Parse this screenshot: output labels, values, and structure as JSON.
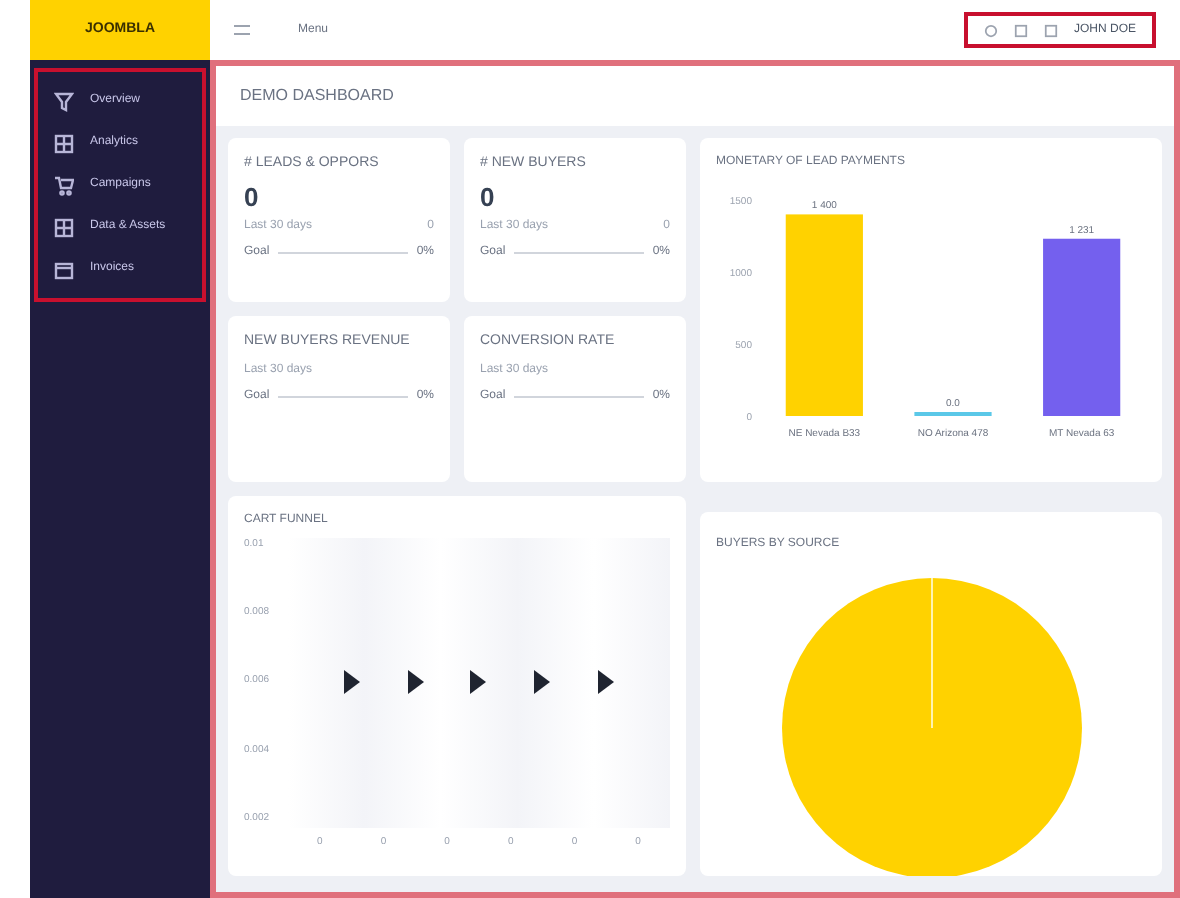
{
  "brand": "JOOMBLA",
  "topbar": {
    "menu_label": "Menu",
    "user": "JOHN DOE"
  },
  "sidebar": {
    "items": [
      {
        "label": "Overview",
        "kind": "funnel",
        "selected": false
      },
      {
        "label": "Analytics",
        "kind": "grid",
        "selected": false
      },
      {
        "label": "Campaigns",
        "kind": "cart",
        "selected": false
      },
      {
        "label": "Data & Assets",
        "kind": "grid",
        "selected": false
      },
      {
        "label": "Invoices",
        "kind": "calendar",
        "selected": false
      }
    ]
  },
  "page_title": "DEMO DASHBOARD",
  "metrics": [
    {
      "title": "# LEADS & OPPORS",
      "value": "0",
      "period": "Last 30 days",
      "period_value": "0",
      "goal_label": "Goal",
      "goal_value": "0%"
    },
    {
      "title": "# NEW BUYERS",
      "value": "0",
      "period": "Last 30 days",
      "period_value": "0",
      "goal_label": "Goal",
      "goal_value": "0%"
    },
    {
      "title": "NEW BUYERS REVENUE",
      "period": "Last 30 days",
      "goal_label": "Goal",
      "goal_value": "0%"
    },
    {
      "title": "CONVERSION RATE",
      "period": "Last 30 days",
      "goal_label": "Goal",
      "goal_value": "0%"
    }
  ],
  "bar_card": {
    "chart_data": {
      "type": "bar",
      "title": "MONETARY OF LEAD PAYMENTS",
      "categories": [
        "NE Nevada B33",
        "NO Arizona 478",
        "MT Nevada 63"
      ],
      "values": [
        1400,
        0,
        1231
      ],
      "colors": [
        "#ffd200",
        "#5bc8e8",
        "#7460ee"
      ],
      "ylim": [
        0,
        1500
      ],
      "yticks": [
        0,
        500,
        1000,
        1500
      ],
      "value_labels": [
        "1 400",
        "0.0",
        "1 231"
      ]
    }
  },
  "funnel_card": {
    "title": "CART FUNNEL",
    "y_ticks": [
      "0.01",
      "0.008",
      "0.006",
      "0.004",
      "0.002"
    ],
    "x_ticks": [
      "0",
      "0",
      "0",
      "0",
      "0",
      "0"
    ]
  },
  "pie_card": {
    "title": "BUYERS BY SOURCE"
  }
}
